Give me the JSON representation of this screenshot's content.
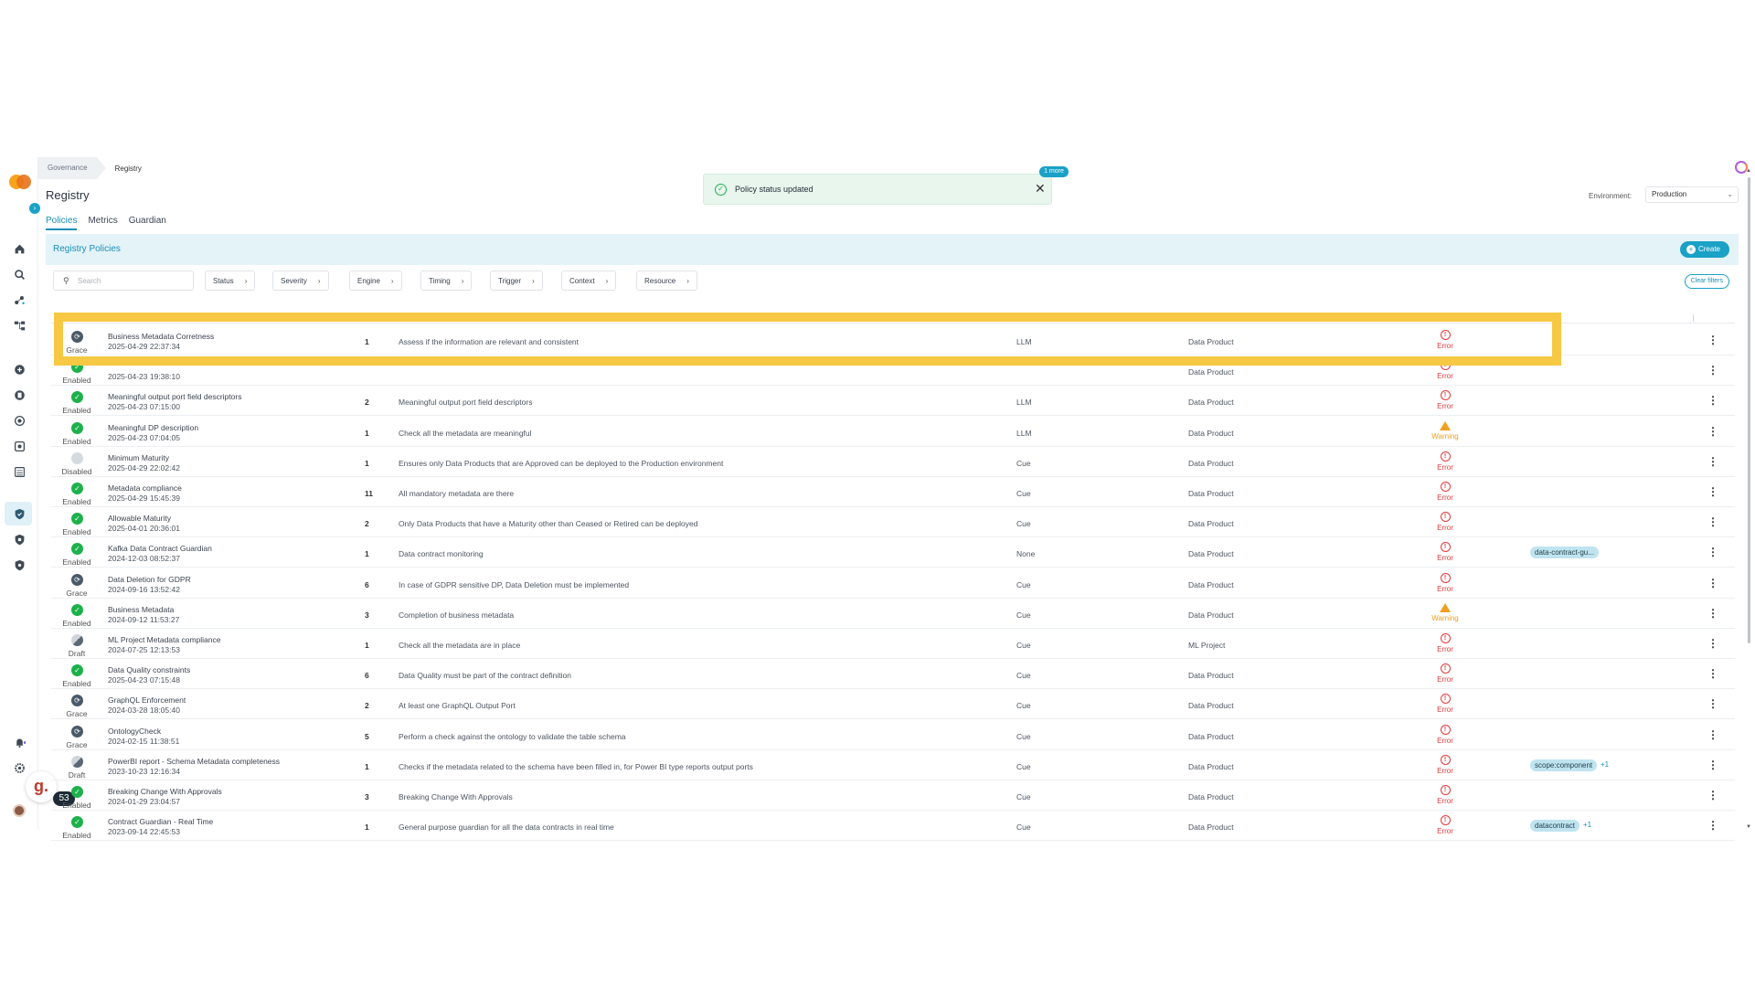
{
  "breadcrumb": {
    "items": [
      "Governance",
      "Registry"
    ]
  },
  "page_title": "Registry",
  "tabs": [
    {
      "label": "Policies",
      "active": true
    },
    {
      "label": "Metrics",
      "active": false
    },
    {
      "label": "Guardian",
      "active": false
    }
  ],
  "toast": {
    "message": "Policy status updated",
    "more_badge": "1 more",
    "close": "✕"
  },
  "environment": {
    "label": "Environment:",
    "value": "Production"
  },
  "panel": {
    "title": "Registry Policies",
    "create_label": "Create"
  },
  "filters": {
    "search_placeholder": "Search",
    "chips": [
      "Status",
      "Severity",
      "Engine",
      "Timing",
      "Trigger",
      "Context",
      "Resource"
    ],
    "clear_label": "Clear filters"
  },
  "help": {
    "count": "53",
    "logo": "g."
  },
  "colors": {
    "accent": "#1aa1c6",
    "enabled": "#1db14b",
    "error": "#e03a3a",
    "warning": "#f0a020",
    "highlight": "#f7c843"
  },
  "rows": [
    {
      "status": "Grace",
      "name": "Business Metadata Corretness",
      "date": "2025-04-29 22:37:34",
      "version": "1",
      "description": "Assess if the information are relevant and consistent",
      "engine": "LLM",
      "resource": "Data Product",
      "severity": "Error",
      "tag": "",
      "tag_more": ""
    },
    {
      "status": "Enabled",
      "name": "",
      "date": "2025-04-23 19:38:10",
      "version": "",
      "description": "",
      "engine": "",
      "resource": "Data Product",
      "severity": "Error",
      "tag": "",
      "tag_more": ""
    },
    {
      "status": "Enabled",
      "name": "Meaningful output port field descriptors",
      "date": "2025-04-23 07:15:00",
      "version": "2",
      "description": "Meaningful output port field descriptors",
      "engine": "LLM",
      "resource": "Data Product",
      "severity": "Error",
      "tag": "",
      "tag_more": ""
    },
    {
      "status": "Enabled",
      "name": "Meaningful DP description",
      "date": "2025-04-23 07:04:05",
      "version": "1",
      "description": "Check all the metadata are meaningful",
      "engine": "LLM",
      "resource": "Data Product",
      "severity": "Warning",
      "tag": "",
      "tag_more": ""
    },
    {
      "status": "Disabled",
      "name": "Minimum Maturity",
      "date": "2025-04-29 22:02:42",
      "version": "1",
      "description": "Ensures only Data Products that are Approved can be deployed to the Production environment",
      "engine": "Cue",
      "resource": "Data Product",
      "severity": "Error",
      "tag": "",
      "tag_more": ""
    },
    {
      "status": "Enabled",
      "name": "Metadata compliance",
      "date": "2025-04-29 15:45:39",
      "version": "11",
      "description": "All mandatory metadata are there",
      "engine": "Cue",
      "resource": "Data Product",
      "severity": "Error",
      "tag": "",
      "tag_more": ""
    },
    {
      "status": "Enabled",
      "name": "Allowable Maturity",
      "date": "2025-04-01 20:36:01",
      "version": "2",
      "description": "Only Data Products that have a Maturity other than Ceased or Retired can be deployed",
      "engine": "Cue",
      "resource": "Data Product",
      "severity": "Error",
      "tag": "",
      "tag_more": ""
    },
    {
      "status": "Enabled",
      "name": "Kafka Data Contract Guardian",
      "date": "2024-12-03 08:52:37",
      "version": "1",
      "description": "Data contract monitoring",
      "engine": "None",
      "resource": "Data Product",
      "severity": "Error",
      "tag": "data-contract-gu...",
      "tag_more": ""
    },
    {
      "status": "Grace",
      "name": "Data Deletion for GDPR",
      "date": "2024-09-16 13:52:42",
      "version": "6",
      "description": "In case of GDPR sensitive DP, Data Deletion must be implemented",
      "engine": "Cue",
      "resource": "Data Product",
      "severity": "Error",
      "tag": "",
      "tag_more": ""
    },
    {
      "status": "Enabled",
      "name": "Business Metadata",
      "date": "2024-09-12 11:53:27",
      "version": "3",
      "description": "Completion of business metadata",
      "engine": "Cue",
      "resource": "Data Product",
      "severity": "Warning",
      "tag": "",
      "tag_more": ""
    },
    {
      "status": "Draft",
      "name": "ML Project Metadata compliance",
      "date": "2024-07-25 12:13:53",
      "version": "1",
      "description": "Check all the metadata are in place",
      "engine": "Cue",
      "resource": "ML Project",
      "severity": "Error",
      "tag": "",
      "tag_more": ""
    },
    {
      "status": "Enabled",
      "name": "Data Quality constraints",
      "date": "2025-04-23 07:15:48",
      "version": "6",
      "description": "Data Quality must be part of the contract definition",
      "engine": "Cue",
      "resource": "Data Product",
      "severity": "Error",
      "tag": "",
      "tag_more": ""
    },
    {
      "status": "Grace",
      "name": "GraphQL Enforcement",
      "date": "2024-03-28 18:05:40",
      "version": "2",
      "description": "At least one GraphQL Output Port",
      "engine": "Cue",
      "resource": "Data Product",
      "severity": "Error",
      "tag": "",
      "tag_more": ""
    },
    {
      "status": "Grace",
      "name": "OntologyCheck",
      "date": "2024-02-15 11:38:51",
      "version": "5",
      "description": "Perform a check against the ontology to validate the table schema",
      "engine": "Cue",
      "resource": "Data Product",
      "severity": "Error",
      "tag": "",
      "tag_more": ""
    },
    {
      "status": "Draft",
      "name": "PowerBI report - Schema Metadata completeness",
      "date": "2023-10-23 12:16:34",
      "version": "1",
      "description": "Checks if the metadata related to the schema have been filled in, for Power BI type reports output ports",
      "engine": "Cue",
      "resource": "Data Product",
      "severity": "Error",
      "tag": "scope:component",
      "tag_more": "+1"
    },
    {
      "status": "Enabled",
      "name": "Breaking Change With Approvals",
      "date": "2024-01-29 23:04:57",
      "version": "3",
      "description": "Breaking Change With Approvals",
      "engine": "Cue",
      "resource": "Data Product",
      "severity": "Error",
      "tag": "",
      "tag_more": ""
    },
    {
      "status": "Enabled",
      "name": "Contract Guardian - Real Time",
      "date": "2023-09-14 22:45:53",
      "version": "1",
      "description": "General purpose guardian for all the data contracts in real time",
      "engine": "Cue",
      "resource": "Data Product",
      "severity": "Error",
      "tag": "datacontract",
      "tag_more": "+1"
    }
  ]
}
